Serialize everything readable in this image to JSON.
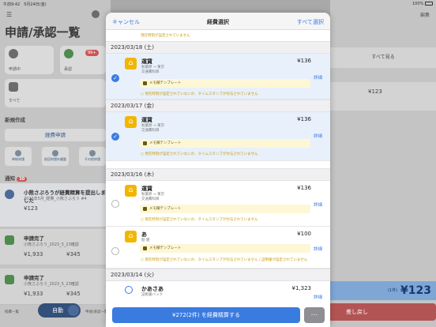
{
  "status_bar": {
    "time": "午前9:42　5月24日(金)",
    "battery": "100%"
  },
  "background_left": {
    "title": "申請/承認一覧",
    "cards": [
      {
        "label": "申請中"
      },
      {
        "label": "承認",
        "badge": "99+"
      },
      {
        "label": "すべて"
      }
    ],
    "section_new": "新規作成",
    "expense_button": "経費申請",
    "quick_actions": [
      "単純申請",
      "前回申請を複製",
      "その他申請"
    ],
    "notifications_label": "通知",
    "notifications_count": "30",
    "notifications": [
      {
        "title": "小熊さぶろうが経費精算を提出しました",
        "subtitle": "2023年5月_経費_小熊さぶろう #4",
        "amount_a": "¥123",
        "amount_b": ""
      },
      {
        "title": "申請完了",
        "subtitle": "小熊さぶろう_2023_5_23確認",
        "amount_a": "¥1,933",
        "amount_b": "¥345"
      },
      {
        "title": "申請完了",
        "subtitle": "小熊さぶろう_2023_5_23確認",
        "amount_a": "¥1,933",
        "amount_b": "¥345"
      }
    ],
    "fab_label": "自動",
    "tabs": [
      "経費一覧",
      "申請/承認一覧"
    ]
  },
  "background_right": {
    "edit": "編集",
    "see_all": "すべて見る",
    "row_amount": "¥123",
    "total_label": "(1件)",
    "total_amount": "¥123",
    "reject_label": "差し戻し"
  },
  "sheet": {
    "cancel": "キャンセル",
    "title": "経費選択",
    "select_all": "すべて選択",
    "top_warning": "現在時刻が設定されていません",
    "groups": [
      {
        "date": "2023/03/18 (土)",
        "items": [
          {
            "name": "運賃",
            "route": "秋葉原 → 東京",
            "category": "交通費科目",
            "amount": "¥136",
            "memo": "メモ欄テンプレート",
            "warning": "現在時刻が設定されていないか、タイムスタンプが付与されていません",
            "selected": true,
            "detail": "詳細"
          }
        ]
      },
      {
        "date": "2023/03/17 (金)",
        "items": [
          {
            "name": "運賃",
            "route": "秋葉原 → 東京",
            "category": "交通費科目",
            "amount": "¥136",
            "memo": "メモ欄テンプレート",
            "warning": "現在時刻が設定されていないか、タイムスタンプが付与されていません",
            "selected": true,
            "detail": "詳細"
          }
        ]
      },
      {
        "date": "2023/03/16 (木)",
        "items": [
          {
            "name": "運賃",
            "route": "秋葉原 → 東京",
            "category": "交通費科目",
            "amount": "¥136",
            "memo": "メモ欄テンプレート",
            "warning": "現在時刻が設定されていないか、タイムスタンプが付与されていません",
            "selected": false,
            "detail": "詳細"
          },
          {
            "name": "あ",
            "route": "勘 雑",
            "category": "",
            "amount": "¥100",
            "memo": "メモ欄テンプレート",
            "warning": "現在時刻が設定されていないか、タイムスタンプが付与されていません / 証明書が設定されていません",
            "selected": false,
            "detail": "詳細"
          }
        ]
      },
      {
        "date": "2023/03/14 (火)",
        "items": [
          {
            "name": "かあさあ",
            "route": "証拠書バック",
            "category": "",
            "amount": "¥1,323",
            "memo": "",
            "warning": "",
            "selected": false,
            "detail": "詳細"
          }
        ]
      }
    ],
    "submit_button": "¥272(2件) を経費精算する",
    "more_button": "…"
  }
}
